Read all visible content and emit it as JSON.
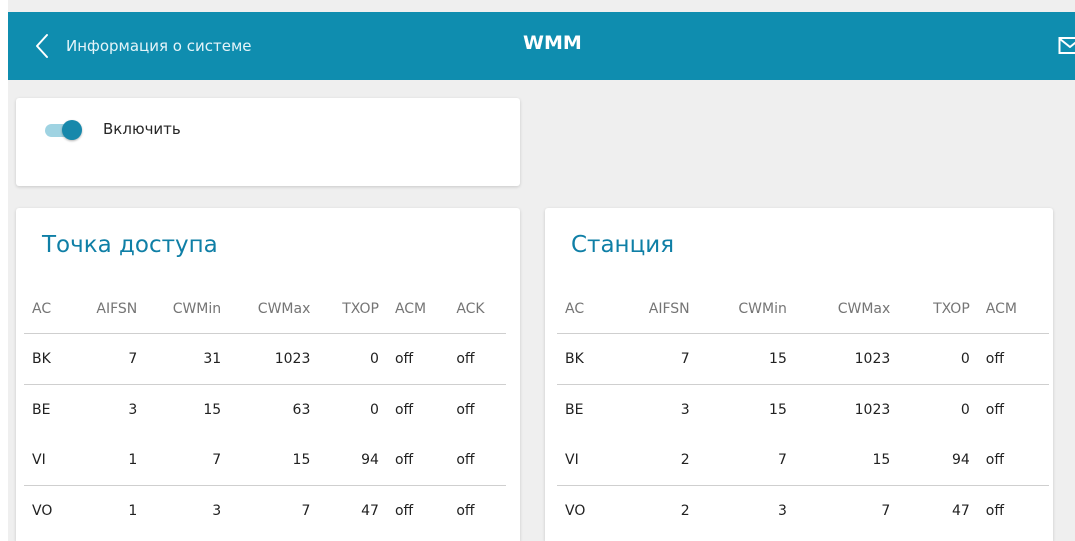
{
  "header": {
    "back_label": "Информация о системе",
    "title": "WMM",
    "icons": {
      "back": "chevron-left-icon",
      "mail": "mail-icon"
    }
  },
  "enable": {
    "label": "Включить",
    "checked": true
  },
  "colors": {
    "header_bg": "#0f8daf",
    "accent": "#1788ab",
    "section_title": "#0f7fa6",
    "page_bg": "#efefef"
  },
  "access_point": {
    "title": "Точка доступа",
    "columns": [
      "AC",
      "AIFSN",
      "CWMin",
      "CWMax",
      "TXOP",
      "ACM",
      "ACK"
    ],
    "rows": [
      [
        "BK",
        "7",
        "31",
        "1023",
        "0",
        "off",
        "off"
      ],
      [
        "BE",
        "3",
        "15",
        "63",
        "0",
        "off",
        "off"
      ],
      [
        "VI",
        "1",
        "7",
        "15",
        "94",
        "off",
        "off"
      ],
      [
        "VO",
        "1",
        "3",
        "7",
        "47",
        "off",
        "off"
      ]
    ]
  },
  "station": {
    "title": "Станция",
    "columns": [
      "AC",
      "AIFSN",
      "CWMin",
      "CWMax",
      "TXOP",
      "ACM"
    ],
    "rows": [
      [
        "BK",
        "7",
        "15",
        "1023",
        "0",
        "off"
      ],
      [
        "BE",
        "3",
        "15",
        "1023",
        "0",
        "off"
      ],
      [
        "VI",
        "2",
        "7",
        "15",
        "94",
        "off"
      ],
      [
        "VO",
        "2",
        "3",
        "7",
        "47",
        "off"
      ]
    ]
  }
}
